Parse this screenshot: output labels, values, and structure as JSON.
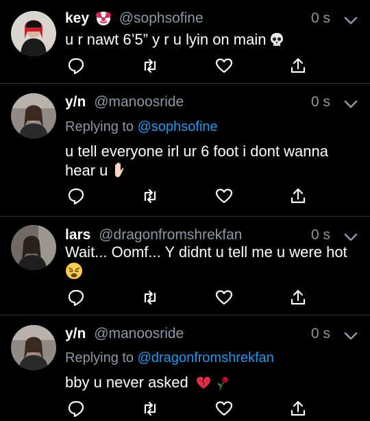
{
  "tweets": [
    {
      "name": "key",
      "handle": "@sophsofine",
      "time": "0 s",
      "reply_prefix": "",
      "reply_to": "",
      "text": "u r nawt 6’5” y r u lyin on main",
      "name_emoji": "clown-emoji",
      "body_emoji": "skull-emoji"
    },
    {
      "name": "y/n",
      "handle": "@manoosride",
      "time": "0 s",
      "reply_prefix": "Replying to",
      "reply_to": "@sophsofine",
      "text": "u tell everyone irl ur 6 foot i dont wanna hear u",
      "body_emoji": "raised-hand-emoji"
    },
    {
      "name": "lars",
      "handle": "@dragonfromshrekfan",
      "time": "0 s",
      "reply_prefix": "",
      "reply_to": "",
      "text": "Wait... Oomf... Y didnt u tell me u were hot",
      "body_emoji": "weary-face-emoji"
    },
    {
      "name": "y/n",
      "handle": "@manoosride",
      "time": "0 s",
      "reply_prefix": "Replying to",
      "reply_to": "@dragonfromshrekfan",
      "text": "bby u never asked",
      "body_emoji": "broken-heart-emoji, wilted-rose-emoji"
    }
  ],
  "colors": {
    "background": "#000000",
    "secondary_text": "#8b98a5",
    "mention": "#1d9bf0",
    "divider": "#2f3336"
  },
  "icons": [
    "reply-icon",
    "retweet-icon",
    "like-icon",
    "share-icon",
    "chevron-down-icon"
  ]
}
